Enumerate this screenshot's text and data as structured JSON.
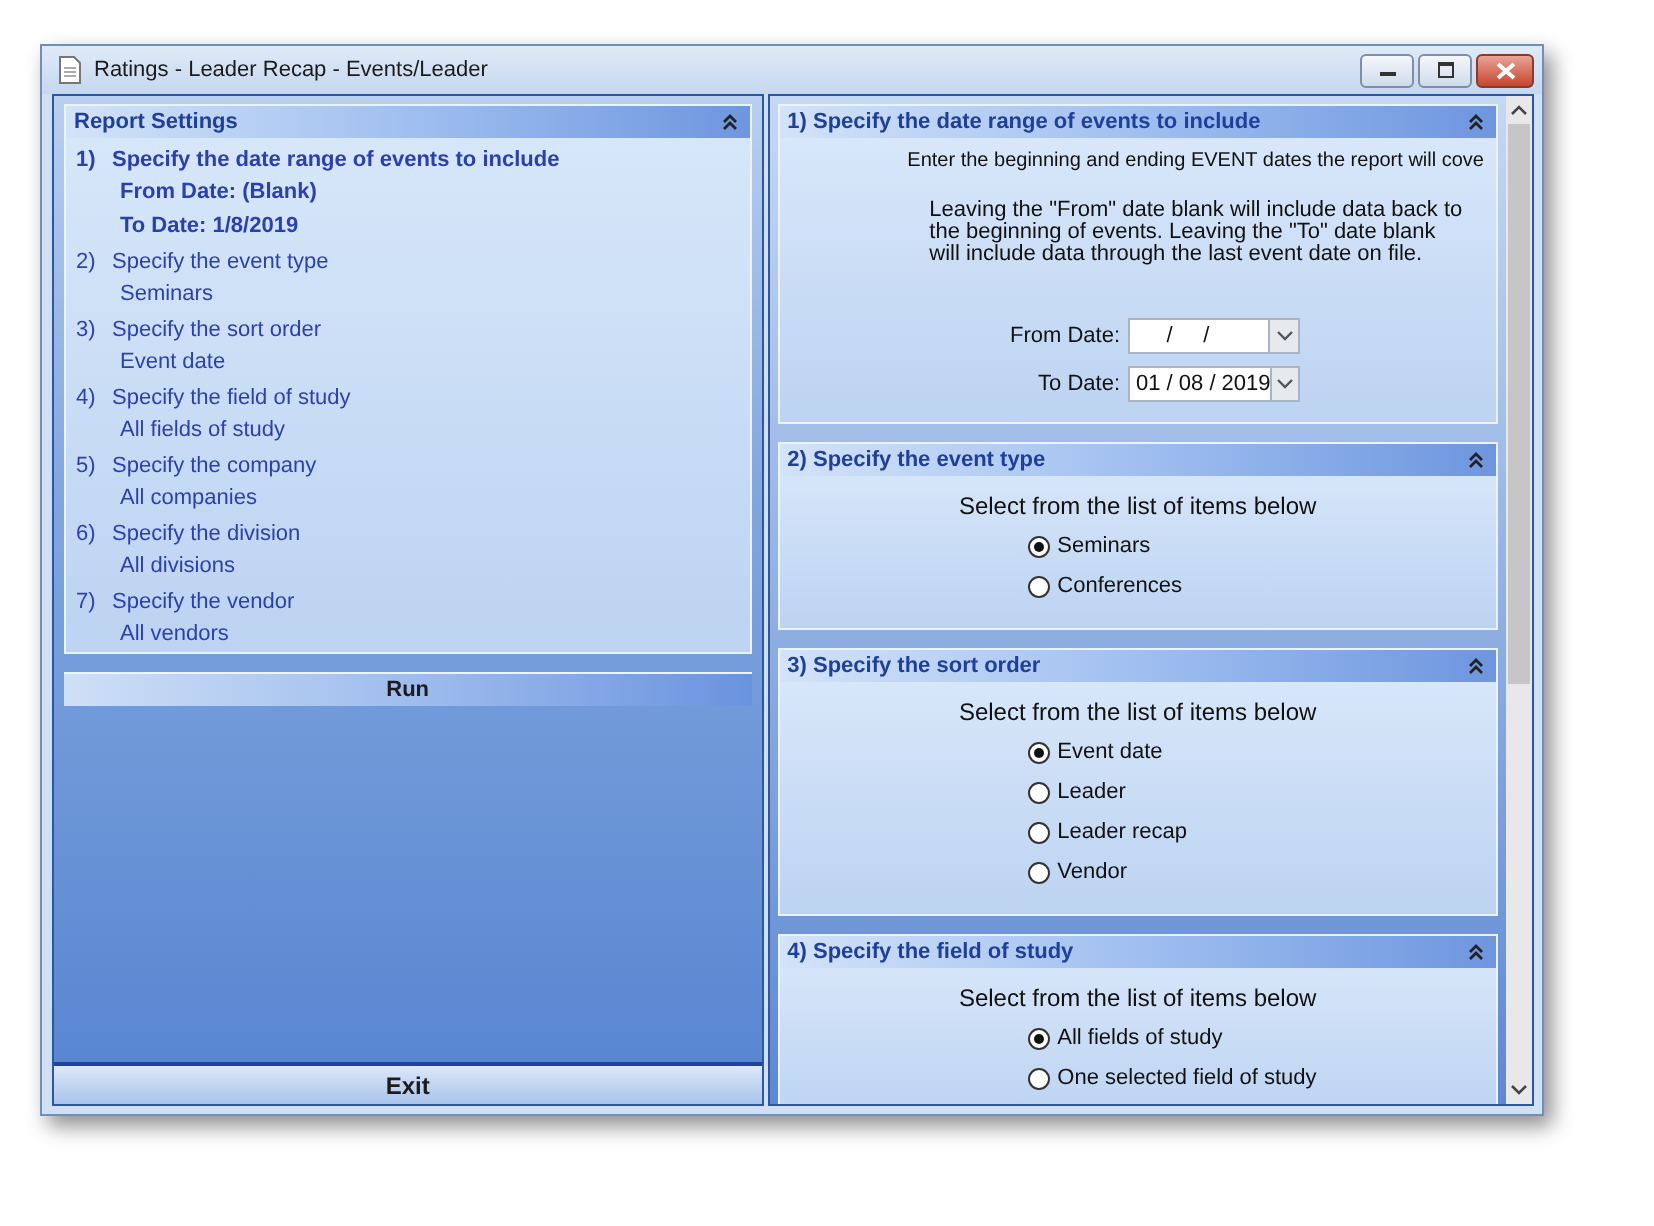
{
  "window": {
    "title": "Ratings - Leader Recap - Events/Leader"
  },
  "summary": {
    "title": "Report Settings",
    "steps": [
      {
        "number": "1)",
        "title": "Specify the date range of events to include",
        "current": true,
        "values": [
          "From Date:  (Blank)",
          "To Date:  1/8/2019"
        ]
      },
      {
        "number": "2)",
        "title": "Specify the event type",
        "current": false,
        "values": [
          "Seminars"
        ]
      },
      {
        "number": "3)",
        "title": "Specify the sort order",
        "current": false,
        "values": [
          "Event date"
        ]
      },
      {
        "number": "4)",
        "title": "Specify the field of study",
        "current": false,
        "values": [
          "All fields of study"
        ]
      },
      {
        "number": "5)",
        "title": "Specify the company",
        "current": false,
        "values": [
          "All companies"
        ]
      },
      {
        "number": "6)",
        "title": "Specify the division",
        "current": false,
        "values": [
          "All divisions"
        ]
      },
      {
        "number": "7)",
        "title": "Specify the vendor",
        "current": false,
        "values": [
          "All vendors"
        ]
      }
    ]
  },
  "run_button": "Run",
  "exit_button": "Exit",
  "sections": [
    {
      "kind": "dates",
      "title": "1)  Specify the date range of events to include",
      "paragraphs": [
        "Enter the beginning and ending EVENT dates the report will cove",
        "Leaving the \"From\" date blank will include data back to the beginning of events.  Leaving the \"To\" date blank will include data through the last event date on file."
      ],
      "fields": [
        {
          "label": "From Date:",
          "value": "     /     /"
        },
        {
          "label": "To Date:",
          "value": "01 / 08 / 2019"
        }
      ]
    },
    {
      "kind": "radios",
      "title": "2)  Specify the event type",
      "prompt": "Select from the list of items below",
      "options": [
        {
          "label": "Seminars",
          "selected": true
        },
        {
          "label": "Conferences",
          "selected": false
        }
      ]
    },
    {
      "kind": "radios",
      "title": "3)  Specify the sort order",
      "prompt": "Select from the list of items below",
      "options": [
        {
          "label": "Event date",
          "selected": true
        },
        {
          "label": "Leader",
          "selected": false
        },
        {
          "label": "Leader recap",
          "selected": false
        },
        {
          "label": "Vendor",
          "selected": false
        }
      ]
    },
    {
      "kind": "radios",
      "title": "4)  Specify the field of study",
      "prompt": "Select from the list of items below",
      "options": [
        {
          "label": "All fields of study",
          "selected": true
        },
        {
          "label": "One selected field of study",
          "selected": false
        }
      ]
    }
  ]
}
